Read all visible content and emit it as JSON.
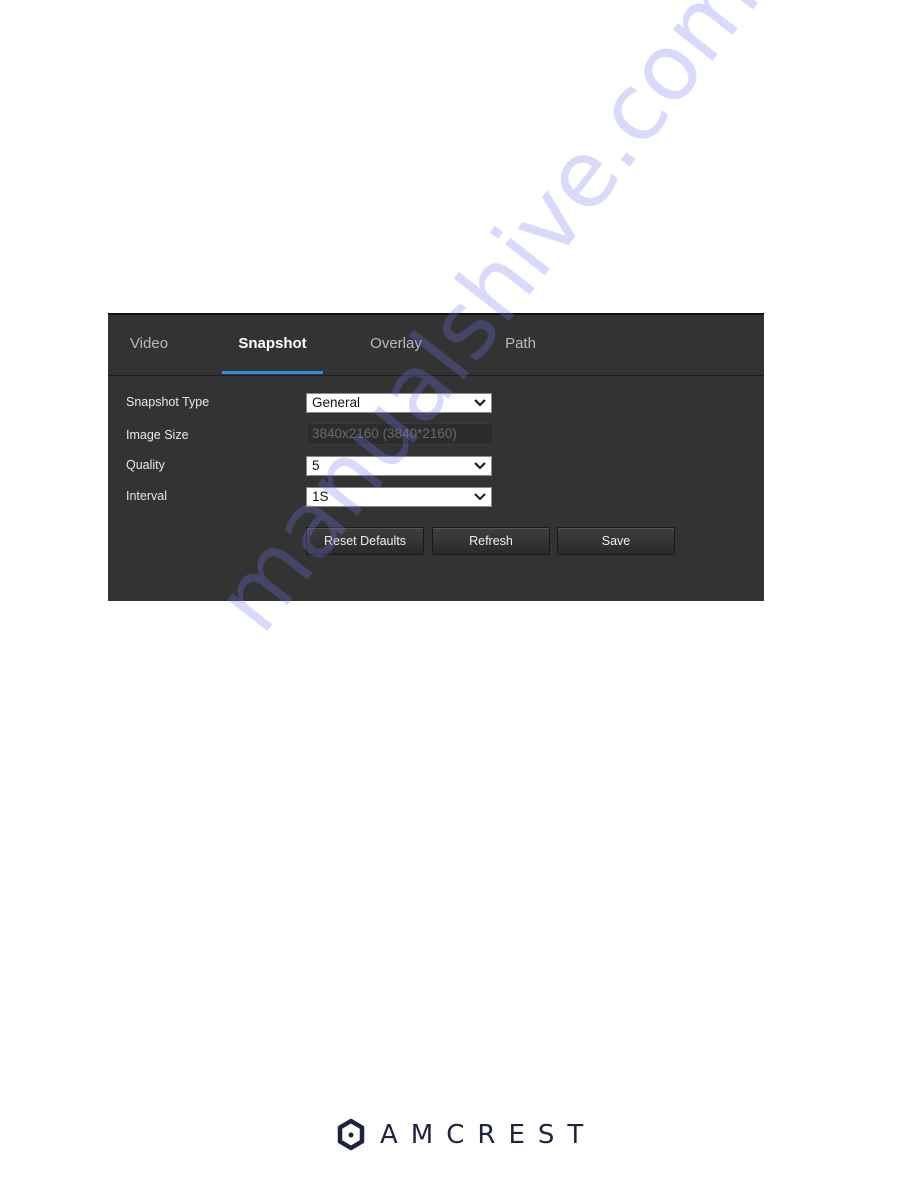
{
  "tabs": [
    {
      "label": "Video",
      "active": false
    },
    {
      "label": "Snapshot",
      "active": true
    },
    {
      "label": "Overlay",
      "active": false
    },
    {
      "label": "Path",
      "active": false
    }
  ],
  "form": {
    "snapshot_type": {
      "label": "Snapshot Type",
      "value": "General"
    },
    "image_size": {
      "label": "Image Size",
      "value": "3840x2160 (3840*2160)"
    },
    "quality": {
      "label": "Quality",
      "value": "5"
    },
    "interval": {
      "label": "Interval",
      "value": "1S"
    }
  },
  "buttons": {
    "reset_defaults": "Reset Defaults",
    "refresh": "Refresh",
    "save": "Save"
  },
  "colors": {
    "panel_bg": "#333333",
    "tab_accent": "#2f8ee0",
    "logo": "#1f2340"
  },
  "watermark": "manualshive.com",
  "brand": {
    "name": "AMCREST",
    "icon": "amcrest-hexagon-logo-icon"
  }
}
